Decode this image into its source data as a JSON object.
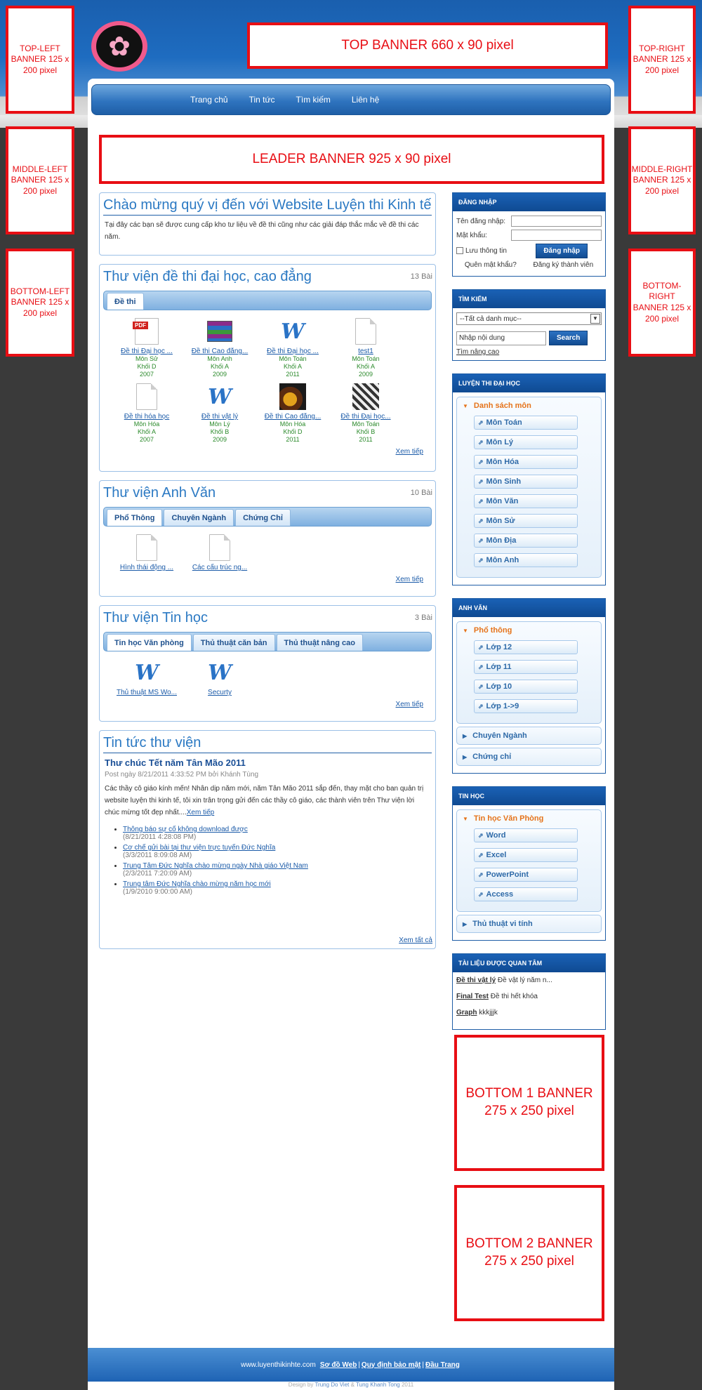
{
  "banners": {
    "top_left": "TOP-LEFT BANNER 125 x 200 pixel",
    "top_right": "TOP-RIGHT BANNER 125 x 200 pixel",
    "middle_left": "MIDDLE-LEFT BANNER 125 x 200 pixel",
    "middle_right": "MIDDLE-RIGHT BANNER 125 x 200 pixel",
    "bottom_left": "BOTTOM-LEFT BANNER 125 x 200 pixel",
    "bottom_right": "BOTTOM-RIGHT BANNER 125 x 200 pixel",
    "top": "TOP BANNER 660 x 90 pixel",
    "leader": "LEADER BANNER   925 x 90 pixel",
    "bottom1": "BOTTOM 1 BANNER 275 x 250 pixel",
    "bottom2": "BOTTOM 2 BANNER 275 x 250 pixel"
  },
  "nav": [
    "Trang chủ",
    "Tin tức",
    "Tìm kiếm",
    "Liên hệ"
  ],
  "welcome": {
    "title": "Chào mừng quý vị đến với Website Luyện thi Kinh tế",
    "text": "Tại đây các bạn sẽ được cung cấp kho tư liệu về đề thi cũng như các giải đáp thắc mắc về đề thi các năm."
  },
  "lib1": {
    "title": "Thư viện đề thi đại học, cao đẳng",
    "count": "13 Bài",
    "tabs": [
      "Đề thi"
    ],
    "more": "Xem tiếp",
    "items": [
      {
        "icon": "pdf",
        "title": "Đề thi Đại học ...",
        "subject": "Môn Sử",
        "block": "Khối D",
        "year": "2007"
      },
      {
        "icon": "rar",
        "title": "Đề thi Cao đẳng...",
        "subject": "Môn Anh",
        "block": "Khối A",
        "year": "2009"
      },
      {
        "icon": "w",
        "title": "Đề thi Đại học ...",
        "subject": "Môn Toán",
        "block": "Khối A",
        "year": "2011"
      },
      {
        "icon": "doc",
        "title": "test1",
        "subject": "Môn Toán",
        "block": "Khối A",
        "year": "2009"
      },
      {
        "icon": "doc",
        "title": "Đề thi hóa học",
        "subject": "Môn Hóa",
        "block": "Khối A",
        "year": "2007"
      },
      {
        "icon": "w",
        "title": "Đề thi vật lý",
        "subject": "Môn Lý",
        "block": "Khối B",
        "year": "2009"
      },
      {
        "icon": "img1",
        "title": "Đề thi Cao đẳng...",
        "subject": "Môn Hóa",
        "block": "Khối D",
        "year": "2011"
      },
      {
        "icon": "img2",
        "title": "Đề thi Đại học...",
        "subject": "Môn Toán",
        "block": "Khối B",
        "year": "2011"
      }
    ]
  },
  "lib2": {
    "title": "Thư viện Anh Văn",
    "count": "10 Bài",
    "tabs": [
      "Phổ Thông",
      "Chuyên Ngành",
      "Chứng Chỉ"
    ],
    "more": "Xem tiếp",
    "items": [
      {
        "icon": "doc",
        "title": "Hình thái động ..."
      },
      {
        "icon": "doc",
        "title": "Các cấu trúc ng..."
      }
    ]
  },
  "lib3": {
    "title": "Thư viện Tin học",
    "count": "3 Bài",
    "tabs": [
      "Tin học Văn phòng",
      "Thủ thuật căn bản",
      "Thủ thuật nâng cao"
    ],
    "more": "Xem tiếp",
    "items": [
      {
        "icon": "w",
        "title": "Thủ thuật MS Wo..."
      },
      {
        "icon": "w",
        "title": "Securty"
      }
    ]
  },
  "news": {
    "title": "Tin tức thư viện",
    "headline": "Thư chúc Tết năm Tân Mão 2011",
    "meta": "Post ngày 8/21/2011 4:33:52 PM bởi Khánh Tùng",
    "body": "Các thầy cô giáo kính mến! Nhân dịp năm mới, năm Tân Mão 2011 sắp đến, thay mặt cho ban quản trị website luyện thi kinh tế, tôi xin trân trọng gửi đến các thầy cô giáo, các thành viên trên Thư viện lời chúc mừng tốt đẹp nhất....",
    "read_more": "Xem tiếp",
    "items": [
      {
        "title": "Thông báo sự cố không download được",
        "date": "(8/21/2011 4:28:08 PM)"
      },
      {
        "title": "Cơ chế gửi bài tại thư viện trực tuyến Đức Nghĩa",
        "date": "(3/3/2011 8:09:08 AM)"
      },
      {
        "title": "Trung Tâm Đức Nghĩa chào mừng ngày Nhà giáo Việt Nam",
        "date": "(2/3/2011 7:20:09 AM)"
      },
      {
        "title": "Trung tâm Đức Nghĩa chào mừng năm học mới",
        "date": "(1/9/2010 9:00:00 AM)"
      }
    ],
    "all": "Xem tất cả"
  },
  "login": {
    "header": "ĐĂNG NHẬP",
    "user_label": "Tên đăng nhập:",
    "pass_label": "Mật khẩu:",
    "remember": "Lưu thông tin",
    "button": "Đăng nhập",
    "forgot": "Quên mật khẩu?",
    "register": "Đăng ký thành viên"
  },
  "search": {
    "header": "TÌM KIẾM",
    "category": "--Tất cả danh mục--",
    "placeholder": "Nhập nội dung",
    "button": "Search",
    "advanced": "Tìm nâng cao"
  },
  "exam": {
    "header": "LUYỆN THI ĐẠI HỌC",
    "group": "Danh sách môn",
    "items": [
      "Môn Toán",
      "Môn Lý",
      "Môn Hóa",
      "Môn Sinh",
      "Môn Văn",
      "Môn Sử",
      "Môn Địa",
      "Môn Anh"
    ]
  },
  "english": {
    "header": "ANH VĂN",
    "group": "Phổ thông",
    "items": [
      "Lớp 12",
      "Lớp 11",
      "Lớp 10",
      "Lớp 1->9"
    ],
    "others": [
      "Chuyên Ngành",
      "Chứng chỉ"
    ]
  },
  "it": {
    "header": "TIN HỌC",
    "group": "Tin học Văn Phòng",
    "items": [
      "Word",
      "Excel",
      "PowerPoint",
      "Access"
    ],
    "others": [
      "Thủ thuật vi tính"
    ]
  },
  "docs": {
    "header": "TÀI LIỆU ĐƯỢC QUAN TÂM",
    "items": [
      {
        "title": "Đề thi vật lý",
        "desc": "Đề vật lý năm n..."
      },
      {
        "title": "Final Test",
        "desc": "Đề thi hết khóa"
      },
      {
        "title": "Graph",
        "desc": "kkkjjjk"
      }
    ]
  },
  "footer": {
    "site": "www.luyenthikinhte.com",
    "links": [
      "Sơ đồ Web",
      "Quy định bảo mật",
      "Đầu Trang"
    ],
    "credit_prefix": "Design by",
    "credit_a": "Trung Do Viet",
    "credit_and": "&",
    "credit_b": "Tung Khanh Tong",
    "credit_year": "2011"
  }
}
